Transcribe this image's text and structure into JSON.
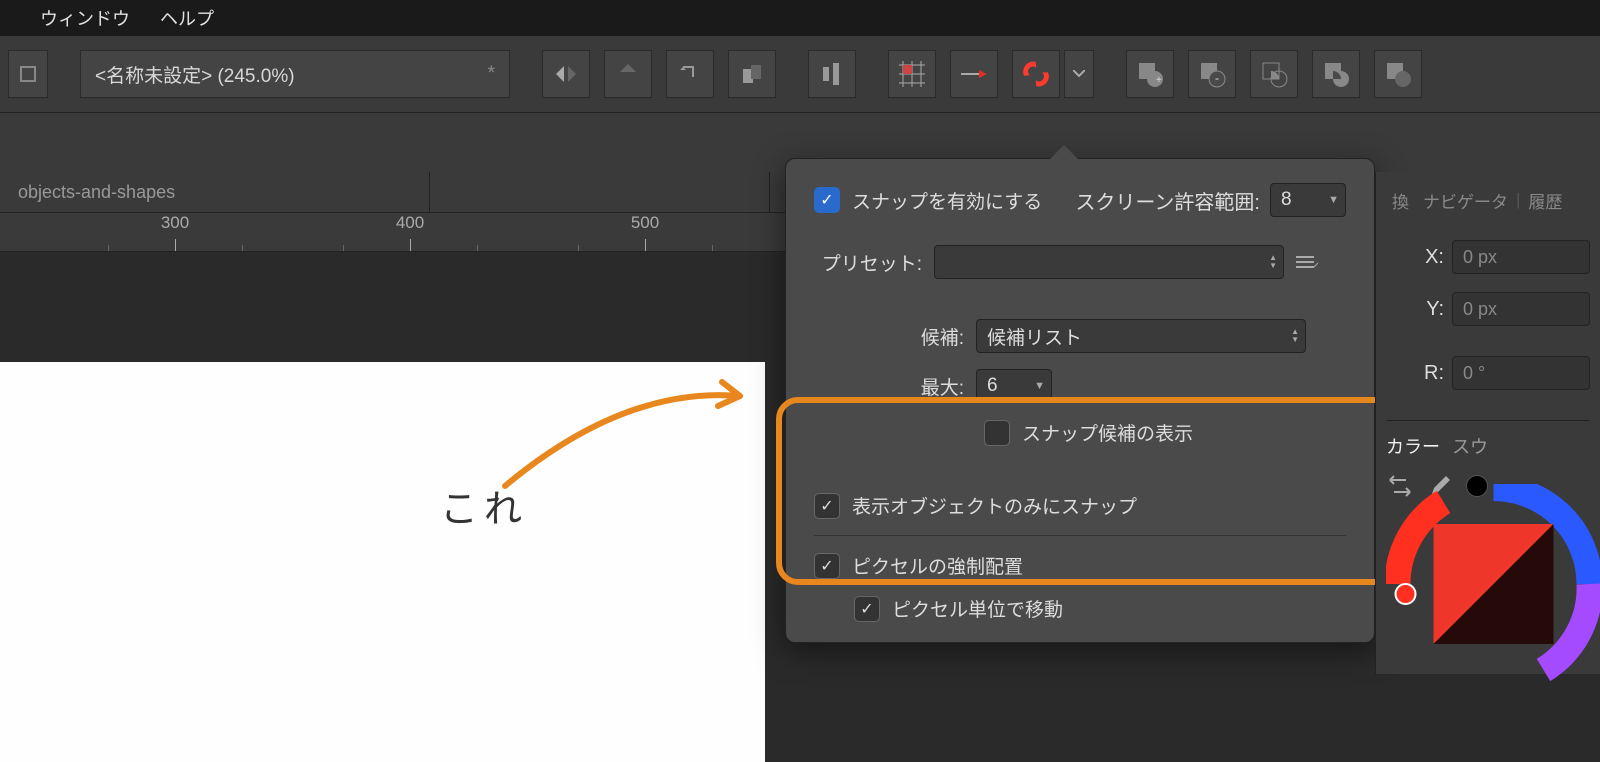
{
  "menubar": {
    "items": [
      "ウィンドウ",
      "ヘルプ"
    ]
  },
  "document": {
    "title": "<名称未設定> (245.0%)",
    "dirty_indicator": "*"
  },
  "tabs": {
    "active": "objects-and-shapes"
  },
  "ruler": {
    "marks": [
      300,
      400,
      500
    ]
  },
  "popover": {
    "enable_snap_label": "スナップを有効にする",
    "screen_tolerance_label": "スクリーン許容範囲:",
    "screen_tolerance_value": "8",
    "preset_label": "プリセット:",
    "preset_value": "",
    "candidates_label": "候補:",
    "candidates_value": "候補リスト",
    "max_label": "最大:",
    "max_value": "6",
    "show_candidates_label": "スナップ候補の表示",
    "only_visible_label": "表示オブジェクトのみにスナップ",
    "force_pixel_label": "ピクセルの強制配置",
    "move_by_pixel_label": "ピクセル単位で移動"
  },
  "transform": {
    "x_label": "X:",
    "x_value": "0 px",
    "y_label": "Y:",
    "y_value": "0 px",
    "r_label": "R:",
    "r_value": "0 °"
  },
  "rp_tabs": {
    "clipped": "換",
    "navigator": "ナビゲータ",
    "history": "履歴"
  },
  "color_tabs": {
    "color": "カラー",
    "swatch": "スウ"
  },
  "annotation": {
    "text": "これ"
  }
}
